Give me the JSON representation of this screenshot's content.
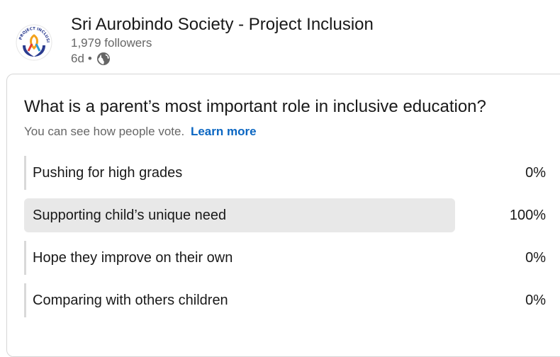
{
  "post": {
    "author": "Sri Aurobindo Society - Project Inclusion",
    "followers": "1,979 followers",
    "time": "6d",
    "separator": "•",
    "visibility_icon": "globe-icon",
    "logo_text": "PROJECT INCLUSION",
    "logo_icon": "ribbon-hands-logo"
  },
  "poll": {
    "question": "What is a parent’s most important role in inclusive education?",
    "note": "You can see how people vote.",
    "learn_more": "Learn more",
    "options": [
      {
        "label": "Pushing for high grades",
        "percent": "0%",
        "fraction": 0.0
      },
      {
        "label": "Supporting child’s unique need",
        "percent": "100%",
        "fraction": 1.0
      },
      {
        "label": "Hope they improve on their own",
        "percent": "0%",
        "fraction": 0.0
      },
      {
        "label": "Comparing with others children",
        "percent": "0%",
        "fraction": 0.0
      }
    ]
  },
  "colors": {
    "link": "#0a66c2",
    "bar_fill": "#e8e8e8",
    "logo_blue": "#2a3b8f"
  }
}
